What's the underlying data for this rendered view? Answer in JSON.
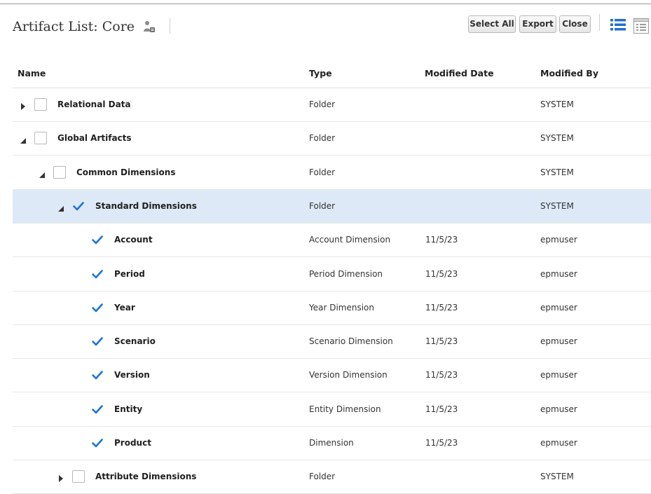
{
  "header": {
    "title": "Artifact List: Core",
    "buttons": {
      "select_all": "Select All",
      "export": "Export",
      "close": "Close"
    },
    "view_icons": [
      "list-view-icon",
      "detail-view-icon"
    ]
  },
  "columns": {
    "name": "Name",
    "type": "Type",
    "modified_date": "Modified Date",
    "modified_by": "Modified By"
  },
  "rows": [
    {
      "name": "Relational Data",
      "type": "Folder",
      "date": "",
      "by": "SYSTEM",
      "level": 0,
      "expand": "collapsed",
      "checked": false,
      "selected": false
    },
    {
      "name": "Global Artifacts",
      "type": "Folder",
      "date": "",
      "by": "SYSTEM",
      "level": 0,
      "expand": "expanded",
      "checked": false,
      "selected": false
    },
    {
      "name": "Common Dimensions",
      "type": "Folder",
      "date": "",
      "by": "SYSTEM",
      "level": 1,
      "expand": "expanded",
      "checked": false,
      "selected": false
    },
    {
      "name": "Standard Dimensions",
      "type": "Folder",
      "date": "",
      "by": "SYSTEM",
      "level": 2,
      "expand": "expanded",
      "checked": true,
      "selected": true
    },
    {
      "name": "Account",
      "type": "Account Dimension",
      "date": "11/5/23",
      "by": "epmuser",
      "level": 3,
      "expand": "none",
      "checked": true,
      "selected": false
    },
    {
      "name": "Period",
      "type": "Period Dimension",
      "date": "11/5/23",
      "by": "epmuser",
      "level": 3,
      "expand": "none",
      "checked": true,
      "selected": false
    },
    {
      "name": "Year",
      "type": "Year Dimension",
      "date": "11/5/23",
      "by": "epmuser",
      "level": 3,
      "expand": "none",
      "checked": true,
      "selected": false
    },
    {
      "name": "Scenario",
      "type": "Scenario Dimension",
      "date": "11/5/23",
      "by": "epmuser",
      "level": 3,
      "expand": "none",
      "checked": true,
      "selected": false
    },
    {
      "name": "Version",
      "type": "Version Dimension",
      "date": "11/5/23",
      "by": "epmuser",
      "level": 3,
      "expand": "none",
      "checked": true,
      "selected": false
    },
    {
      "name": "Entity",
      "type": "Entity Dimension",
      "date": "11/5/23",
      "by": "epmuser",
      "level": 3,
      "expand": "none",
      "checked": true,
      "selected": false
    },
    {
      "name": "Product",
      "type": "Dimension",
      "date": "11/5/23",
      "by": "epmuser",
      "level": 3,
      "expand": "none",
      "checked": true,
      "selected": false
    },
    {
      "name": "Attribute Dimensions",
      "type": "Folder",
      "date": "",
      "by": "SYSTEM",
      "level": 2,
      "expand": "collapsed",
      "checked": false,
      "selected": false
    }
  ],
  "colors": {
    "selected_row": "#dde9f6",
    "checkbox_accent": "#1a73d9",
    "list_icon": "#1f6fd1"
  }
}
